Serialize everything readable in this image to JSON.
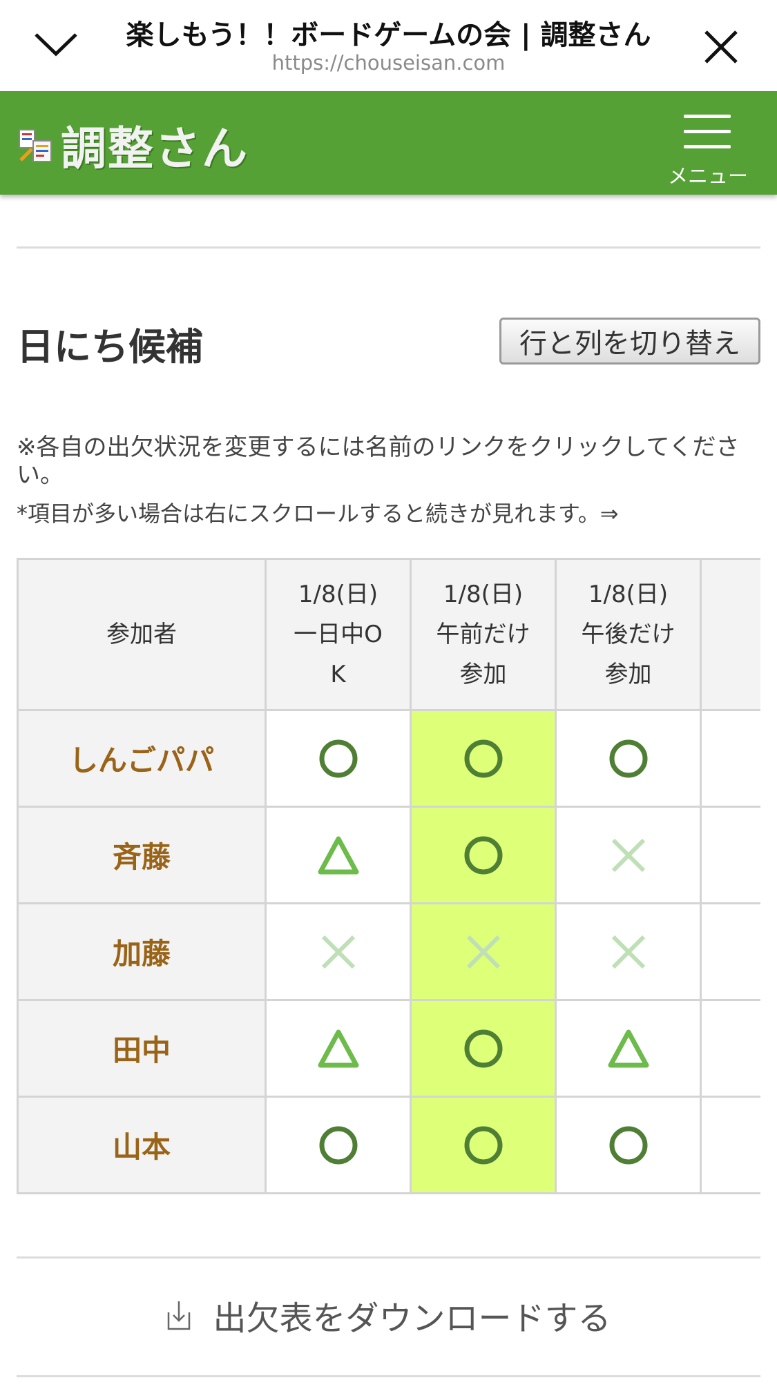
{
  "browser": {
    "page_title": "楽しもう！！ボードゲームの会 | 調整さん",
    "url": "https://chouseisan.com"
  },
  "app": {
    "logo_text": "調整さん",
    "menu_label": "メニュー"
  },
  "section": {
    "title": "日にち候補",
    "switch_button": "行と列を切り替え",
    "note_change": "※各自の出欠状況を変更するには名前のリンクをクリックしてください。",
    "note_scroll": "*項目が多い場合は右にスクロールすると続きが見れます。⇒"
  },
  "table": {
    "participant_header": "参加者",
    "columns": [
      {
        "lines": [
          "1/8(日)",
          "一日中O",
          "K"
        ],
        "highlight": false
      },
      {
        "lines": [
          "1/8(日)",
          "午前だけ",
          "参加"
        ],
        "highlight": true
      },
      {
        "lines": [
          "1/8(日)",
          "午後だけ",
          "参加"
        ],
        "highlight": false
      }
    ],
    "rows": [
      {
        "name": "しんごパパ",
        "marks": [
          "circle",
          "circle",
          "circle"
        ]
      },
      {
        "name": "斉藤",
        "marks": [
          "triangle",
          "circle",
          "cross"
        ]
      },
      {
        "name": "加藤",
        "marks": [
          "cross",
          "cross",
          "cross"
        ]
      },
      {
        "name": "田中",
        "marks": [
          "triangle",
          "circle",
          "triangle"
        ]
      },
      {
        "name": "山本",
        "marks": [
          "circle",
          "circle",
          "circle"
        ]
      }
    ]
  },
  "download": {
    "label": "出欠表をダウンロードする"
  },
  "colors": {
    "header_green": "#56a135",
    "highlight_column": "#deff78",
    "circle": "#4f7f35",
    "triangle": "#6dbb4a",
    "cross": "#bfe0b6",
    "name_text": "#9a6418"
  }
}
